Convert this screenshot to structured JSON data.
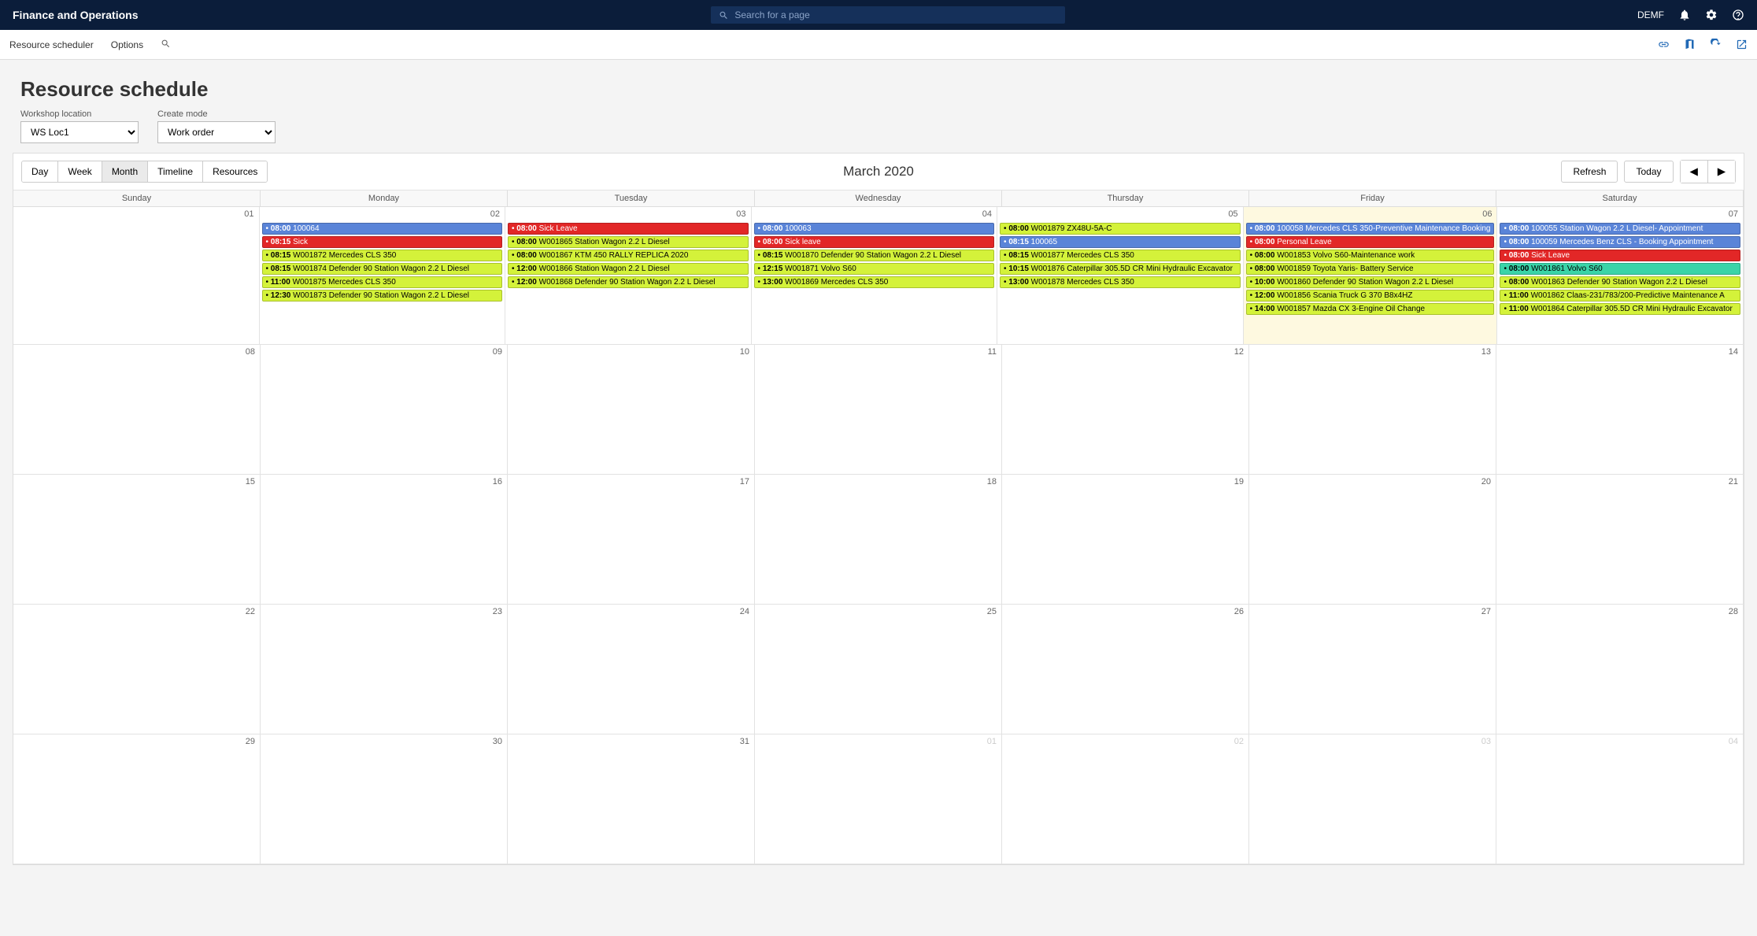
{
  "topbar": {
    "app_title": "Finance and Operations",
    "search_placeholder": "Search for a page",
    "company": "DEMF"
  },
  "actionbar": {
    "tab1": "Resource scheduler",
    "tab2": "Options"
  },
  "page": {
    "title": "Resource schedule",
    "workshop_location_label": "Workshop location",
    "workshop_location_value": "WS Loc1",
    "create_mode_label": "Create mode",
    "create_mode_value": "Work order"
  },
  "cal_toolbar": {
    "views": {
      "day": "Day",
      "week": "Week",
      "month": "Month",
      "timeline": "Timeline",
      "resources": "Resources"
    },
    "month_title": "March 2020",
    "refresh": "Refresh",
    "today": "Today"
  },
  "dow": [
    "Sunday",
    "Monday",
    "Tuesday",
    "Wednesday",
    "Thursday",
    "Friday",
    "Saturday"
  ],
  "weeks": [
    {
      "days": [
        {
          "date": "01",
          "events": []
        },
        {
          "date": "02",
          "events": [
            {
              "time": "08:00",
              "text": "100064",
              "color": "blue"
            },
            {
              "time": "08:15",
              "text": "Sick",
              "color": "red"
            },
            {
              "time": "08:15",
              "text": "W001872 Mercedes CLS 350",
              "color": "lime"
            },
            {
              "time": "08:15",
              "text": "W001874 Defender 90 Station Wagon 2.2 L Diesel",
              "color": "lime"
            },
            {
              "time": "11:00",
              "text": "W001875 Mercedes CLS 350",
              "color": "lime"
            },
            {
              "time": "12:30",
              "text": "W001873 Defender 90 Station Wagon 2.2 L Diesel",
              "color": "lime"
            }
          ]
        },
        {
          "date": "03",
          "events": [
            {
              "time": "08:00",
              "text": "Sick Leave",
              "color": "red"
            },
            {
              "time": "08:00",
              "text": "W001865 Station Wagon 2.2 L Diesel",
              "color": "lime"
            },
            {
              "time": "08:00",
              "text": "W001867 KTM 450 RALLY REPLICA 2020",
              "color": "lime"
            },
            {
              "time": "12:00",
              "text": "W001866 Station Wagon 2.2 L Diesel",
              "color": "lime"
            },
            {
              "time": "12:00",
              "text": "W001868 Defender 90 Station Wagon 2.2 L Diesel",
              "color": "lime"
            }
          ]
        },
        {
          "date": "04",
          "events": [
            {
              "time": "08:00",
              "text": "100063",
              "color": "blue"
            },
            {
              "time": "08:00",
              "text": "Sick leave",
              "color": "red"
            },
            {
              "time": "08:15",
              "text": "W001870 Defender 90 Station Wagon 2.2 L Diesel",
              "color": "lime"
            },
            {
              "time": "12:15",
              "text": "W001871 Volvo S60",
              "color": "lime"
            },
            {
              "time": "13:00",
              "text": "W001869 Mercedes CLS 350",
              "color": "lime"
            }
          ]
        },
        {
          "date": "05",
          "events": [
            {
              "time": "08:00",
              "text": "W001879 ZX48U-5A-C",
              "color": "lime"
            },
            {
              "time": "08:15",
              "text": "100065",
              "color": "blue"
            },
            {
              "time": "08:15",
              "text": "W001877 Mercedes CLS 350",
              "color": "lime"
            },
            {
              "time": "10:15",
              "text": "W001876 Caterpillar 305.5D CR Mini Hydraulic Excavator",
              "color": "lime"
            },
            {
              "time": "13:00",
              "text": "W001878 Mercedes CLS 350",
              "color": "lime"
            }
          ]
        },
        {
          "date": "06",
          "highlight": true,
          "events": [
            {
              "time": "08:00",
              "text": "100058 Mercedes CLS 350-Preventive Maintenance Booking",
              "color": "blue"
            },
            {
              "time": "08:00",
              "text": "Personal Leave",
              "color": "red"
            },
            {
              "time": "08:00",
              "text": "W001853 Volvo S60-Maintenance work",
              "color": "lime"
            },
            {
              "time": "08:00",
              "text": "W001859 Toyota Yaris- Battery Service",
              "color": "lime"
            },
            {
              "time": "10:00",
              "text": "W001860 Defender 90 Station Wagon 2.2 L Diesel",
              "color": "lime"
            },
            {
              "time": "12:00",
              "text": "W001856 Scania Truck G 370 B8x4HZ",
              "color": "lime"
            },
            {
              "time": "14:00",
              "text": "W001857 Mazda CX 3-Engine Oil Change",
              "color": "lime"
            }
          ]
        },
        {
          "date": "07",
          "events": [
            {
              "time": "08:00",
              "text": "100055 Station Wagon 2.2 L Diesel- Appointment",
              "color": "blue"
            },
            {
              "time": "08:00",
              "text": "100059 Mercedes Benz CLS - Booking Appointment",
              "color": "blue"
            },
            {
              "time": "08:00",
              "text": "Sick Leave",
              "color": "red"
            },
            {
              "time": "08:00",
              "text": "W001861 Volvo S60",
              "color": "teal"
            },
            {
              "time": "08:00",
              "text": "W001863 Defender 90 Station Wagon 2.2 L Diesel",
              "color": "lime"
            },
            {
              "time": "11:00",
              "text": "W001862 Claas-231/783/200-Predictive Maintenance A",
              "color": "lime"
            },
            {
              "time": "11:00",
              "text": "W001864 Caterpillar 305.5D CR Mini Hydraulic Excavator",
              "color": "lime"
            }
          ]
        }
      ]
    },
    {
      "days": [
        {
          "date": "08",
          "events": []
        },
        {
          "date": "09",
          "events": []
        },
        {
          "date": "10",
          "events": []
        },
        {
          "date": "11",
          "events": []
        },
        {
          "date": "12",
          "events": []
        },
        {
          "date": "13",
          "events": []
        },
        {
          "date": "14",
          "events": []
        }
      ]
    },
    {
      "days": [
        {
          "date": "15",
          "events": []
        },
        {
          "date": "16",
          "events": []
        },
        {
          "date": "17",
          "events": []
        },
        {
          "date": "18",
          "events": []
        },
        {
          "date": "19",
          "events": []
        },
        {
          "date": "20",
          "events": []
        },
        {
          "date": "21",
          "events": []
        }
      ]
    },
    {
      "days": [
        {
          "date": "22",
          "events": []
        },
        {
          "date": "23",
          "events": []
        },
        {
          "date": "24",
          "events": []
        },
        {
          "date": "25",
          "events": []
        },
        {
          "date": "26",
          "events": []
        },
        {
          "date": "27",
          "events": []
        },
        {
          "date": "28",
          "events": []
        }
      ]
    },
    {
      "days": [
        {
          "date": "29",
          "events": []
        },
        {
          "date": "30",
          "events": []
        },
        {
          "date": "31",
          "events": []
        },
        {
          "date": "01",
          "other": true,
          "events": []
        },
        {
          "date": "02",
          "other": true,
          "events": []
        },
        {
          "date": "03",
          "other": true,
          "events": []
        },
        {
          "date": "04",
          "other": true,
          "events": []
        }
      ]
    }
  ]
}
